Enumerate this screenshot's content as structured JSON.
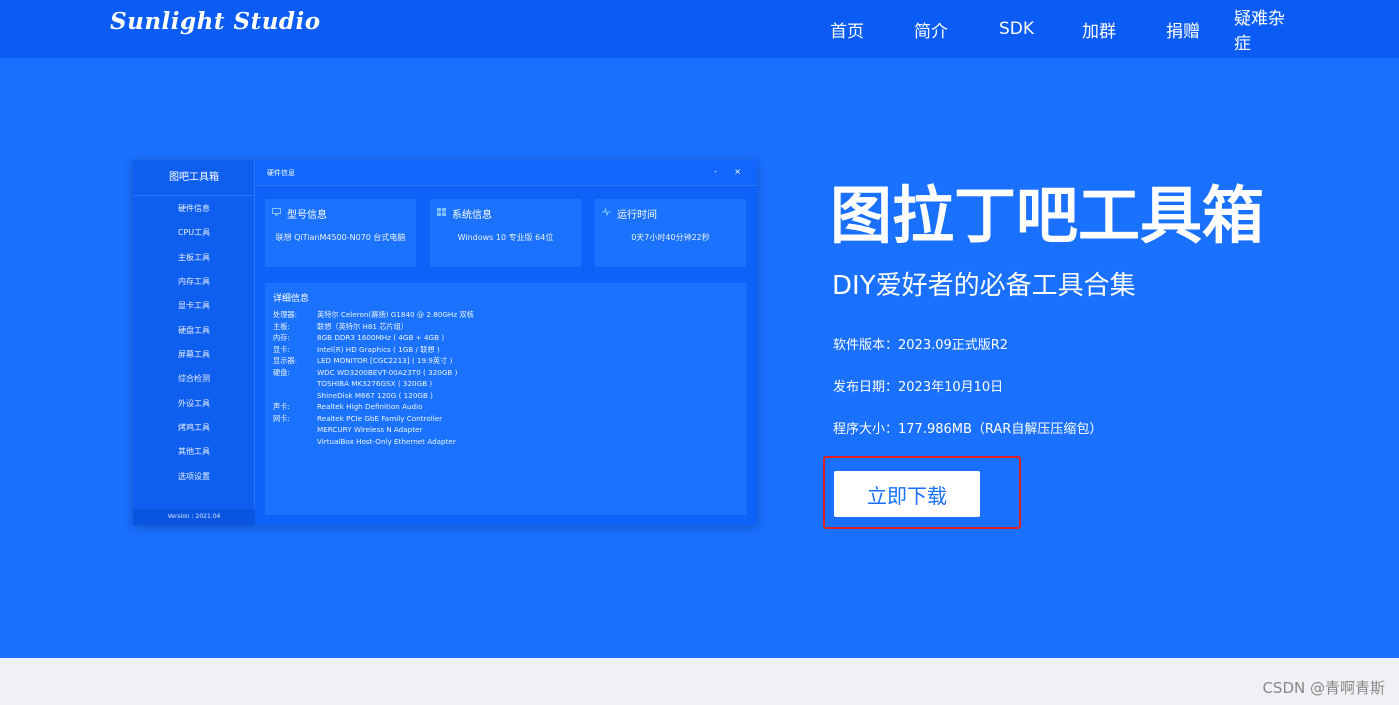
{
  "header": {
    "logo": "Sunlight Studio",
    "nav": [
      "首页",
      "简介",
      "SDK",
      "加群",
      "捐赠",
      "疑难杂症"
    ]
  },
  "app": {
    "side_title": "图吧工具箱",
    "side_items": [
      "硬件信息",
      "CPU工具",
      "主板工具",
      "内存工具",
      "显卡工具",
      "硬盘工具",
      "屏幕工具",
      "综合检测",
      "外设工具",
      "烤鸡工具",
      "其他工具",
      "选项设置"
    ],
    "version": "Version : 2021.04",
    "window_title": "硬件信息",
    "window_min": "-",
    "window_close": "×",
    "cards": [
      {
        "title": "型号信息",
        "value": "联想 QiTianM4500-N070 台式电脑",
        "icon": "monitor-icon"
      },
      {
        "title": "系统信息",
        "value": "Windows 10 专业版 64位",
        "icon": "windows-icon"
      },
      {
        "title": "运行时间",
        "value": "0天7小时40分钟22秒",
        "icon": "pulse-icon"
      }
    ],
    "detail_title": "详细信息",
    "details": [
      {
        "k": "处理器:",
        "v": "英特尔 Celeron(赛扬) G1840 @ 2.80GHz 双核"
      },
      {
        "k": "主板:",
        "v": "联想（英特尔 H81 芯片组）"
      },
      {
        "k": "内存:",
        "v": "8GB DDR3 1600MHz ( 4GB + 4GB )"
      },
      {
        "k": "显卡:",
        "v": "Intel(R) HD Graphics ( 1GB / 联想 )"
      },
      {
        "k": "显示器:",
        "v": "LED MONITOR [CGC2213] ( 19.9英寸 )"
      },
      {
        "k": "硬盘:",
        "v": "WDC WD3200BEVT-00A23T0 ( 320GB )"
      },
      {
        "k": "",
        "v": "TOSHIBA MK3276GSX ( 320GB )"
      },
      {
        "k": "",
        "v": "ShineDisk M667 120G ( 120GB )"
      },
      {
        "k": "声卡:",
        "v": "Realtek High Definition Audio"
      },
      {
        "k": "网卡:",
        "v": "Realtek PCIe GbE Family Controller"
      },
      {
        "k": "",
        "v": "MERCURY Wireless N Adapter"
      },
      {
        "k": "",
        "v": "VirtualBox Host-Only Ethernet Adapter"
      }
    ]
  },
  "info": {
    "title": "图拉丁吧工具箱",
    "subtitle": "DIY爱好者的必备工具合集",
    "version": "软件版本：2023.09正式版R2",
    "date": "发布日期：2023年10月10日",
    "size": "程序大小：177.986MB（RAR自解压压缩包）",
    "download": "立即下载"
  },
  "watermark": "CSDN @青啊青斯",
  "colors": {
    "header": "#0a5cf5",
    "hero": "#1a70ff",
    "highlight": "#e02020"
  }
}
